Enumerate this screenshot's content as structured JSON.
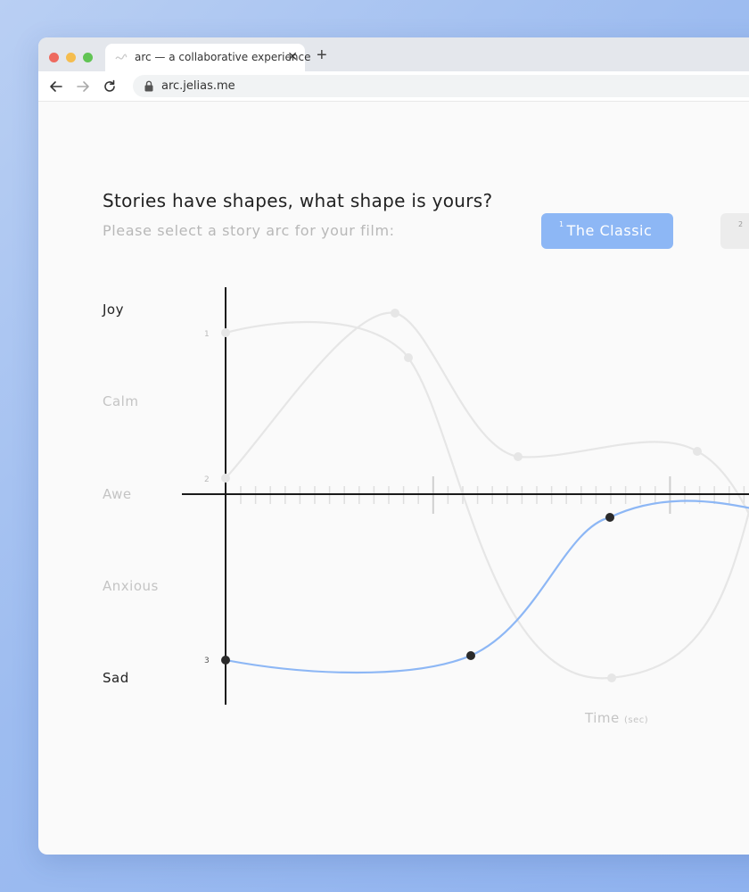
{
  "browser": {
    "tab_title": "arc — a collaborative experience",
    "tab_close": "✕",
    "new_tab": "+",
    "url": "arc.jelias.me"
  },
  "page": {
    "heading": "Stories have shapes, what shape is yours?",
    "subheading": "Please select a story arc for your film:",
    "arc_buttons": [
      {
        "index": "1",
        "label": "The Classic",
        "state": "selected"
      },
      {
        "index": "2",
        "label": "",
        "state": "unselected"
      }
    ],
    "time_label": "Time",
    "time_unit": "(sec)"
  },
  "chart_data": {
    "type": "line",
    "y_categories": [
      "Joy",
      "Calm",
      "Awe",
      "Anxious",
      "Sad"
    ],
    "selected_y_categories": [
      "Joy",
      "Sad"
    ],
    "point_labels": [
      "1",
      "2",
      "3"
    ],
    "series": [
      {
        "name": "",
        "color": "#8db7f5",
        "highlighted": true
      },
      {
        "name": "",
        "color": "#e6e6e6",
        "highlighted": false
      },
      {
        "name": "",
        "color": "#e6e6e6",
        "highlighted": false
      }
    ]
  },
  "colors": {
    "accent": "#8db7f5",
    "axis": "#1a1a1a",
    "muted_curve": "#e6e6e6",
    "point_dark": "#2a2a2a"
  }
}
